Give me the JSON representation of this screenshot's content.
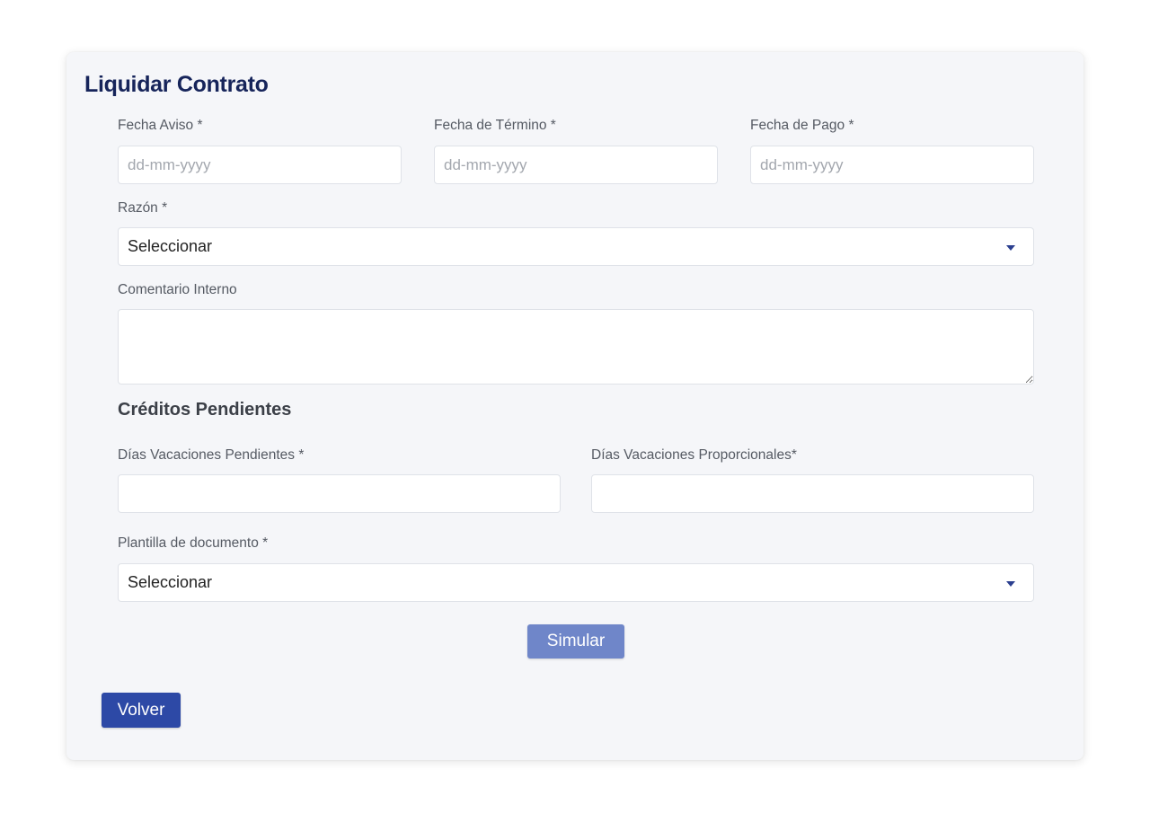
{
  "form": {
    "title": "Liquidar Contrato",
    "fecha_aviso": {
      "label": "Fecha Aviso *",
      "placeholder": "dd-mm-yyyy",
      "value": ""
    },
    "fecha_termino": {
      "label": "Fecha de Término *",
      "placeholder": "dd-mm-yyyy",
      "value": ""
    },
    "fecha_pago": {
      "label": "Fecha de Pago *",
      "placeholder": "dd-mm-yyyy",
      "value": ""
    },
    "razon": {
      "label": "Razón *",
      "selected": "Seleccionar"
    },
    "comentario": {
      "label": "Comentario Interno",
      "value": ""
    },
    "creditos": {
      "title": "Créditos Pendientes"
    },
    "vacaciones_pendientes": {
      "label": "Días Vacaciones Pendientes *",
      "value": ""
    },
    "vacaciones_proporcionales": {
      "label": "Días Vacaciones Proporcionales*",
      "value": ""
    },
    "plantilla": {
      "label": "Plantilla de documento *",
      "selected": "Seleccionar"
    },
    "simular_label": "Simular",
    "volver_label": "Volver"
  },
  "colors": {
    "title": "#16245a",
    "primary": "#2d49a6",
    "primary_light": "#6f86c9",
    "card_bg": "#f5f6f9"
  }
}
